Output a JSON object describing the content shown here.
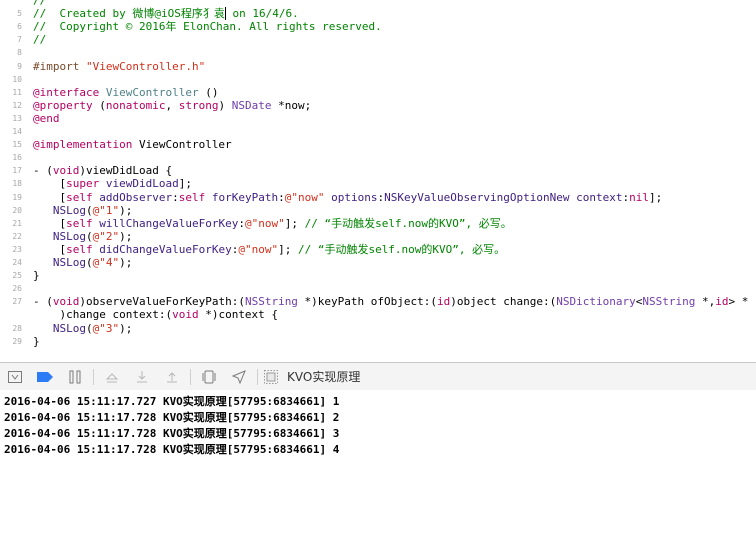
{
  "editor": {
    "colors": {
      "comment": "#008400",
      "keyword": "#b40062",
      "type": "#4f8187",
      "class": "#703daa",
      "method": "#3d1d81",
      "string": "#d12f1b",
      "number": "#272ad8",
      "pre": "#78492a"
    },
    "lines": [
      {
        "num": "",
        "tokens": [
          {
            "c": "comment",
            "t": "//"
          }
        ]
      },
      {
        "num": "5",
        "tokens": [
          {
            "c": "comment",
            "t": "//  Created by 微博@iOS程序犭袁"
          },
          {
            "c": "cursor",
            "t": ""
          },
          {
            "c": "comment",
            "t": " on 16/4/6."
          }
        ]
      },
      {
        "num": "6",
        "tokens": [
          {
            "c": "comment",
            "t": "//  Copyright © 2016年 ElonChan. All rights reserved."
          }
        ]
      },
      {
        "num": "7",
        "tokens": [
          {
            "c": "comment",
            "t": "//"
          }
        ]
      },
      {
        "num": "8",
        "tokens": []
      },
      {
        "num": "9",
        "tokens": [
          {
            "c": "pre",
            "t": "#import "
          },
          {
            "c": "string",
            "t": "\"ViewController.h\""
          }
        ]
      },
      {
        "num": "10",
        "tokens": []
      },
      {
        "num": "11",
        "tokens": [
          {
            "c": "keyword",
            "t": "@interface "
          },
          {
            "c": "type",
            "t": "ViewController"
          },
          {
            "c": "default",
            "t": " ()"
          }
        ]
      },
      {
        "num": "12",
        "tokens": [
          {
            "c": "keyword",
            "t": "@property"
          },
          {
            "c": "default",
            "t": " ("
          },
          {
            "c": "keyword",
            "t": "nonatomic"
          },
          {
            "c": "default",
            "t": ", "
          },
          {
            "c": "keyword",
            "t": "strong"
          },
          {
            "c": "default",
            "t": ") "
          },
          {
            "c": "class",
            "t": "NSDate"
          },
          {
            "c": "default",
            "t": " *now;"
          }
        ]
      },
      {
        "num": "13",
        "tokens": [
          {
            "c": "keyword",
            "t": "@end"
          }
        ]
      },
      {
        "num": "14",
        "tokens": []
      },
      {
        "num": "15",
        "tokens": [
          {
            "c": "keyword",
            "t": "@implementation"
          },
          {
            "c": "default",
            "t": " ViewController"
          }
        ]
      },
      {
        "num": "16",
        "tokens": []
      },
      {
        "num": "17",
        "tokens": [
          {
            "c": "default",
            "t": "- ("
          },
          {
            "c": "keyword",
            "t": "void"
          },
          {
            "c": "default",
            "t": ")viewDidLoad {"
          }
        ]
      },
      {
        "num": "18",
        "tokens": [
          {
            "c": "default",
            "t": "    ["
          },
          {
            "c": "keyword",
            "t": "super"
          },
          {
            "c": "default",
            "t": " "
          },
          {
            "c": "method",
            "t": "viewDidLoad"
          },
          {
            "c": "default",
            "t": "];"
          }
        ]
      },
      {
        "num": "19",
        "tokens": [
          {
            "c": "default",
            "t": "    ["
          },
          {
            "c": "keyword",
            "t": "self"
          },
          {
            "c": "default",
            "t": " "
          },
          {
            "c": "method",
            "t": "addObserver"
          },
          {
            "c": "default",
            "t": ":"
          },
          {
            "c": "keyword",
            "t": "self"
          },
          {
            "c": "default",
            "t": " "
          },
          {
            "c": "method",
            "t": "forKeyPath"
          },
          {
            "c": "default",
            "t": ":"
          },
          {
            "c": "string",
            "t": "@\"now\""
          },
          {
            "c": "default",
            "t": " "
          },
          {
            "c": "method",
            "t": "options"
          },
          {
            "c": "default",
            "t": ":"
          },
          {
            "c": "method",
            "t": "NSKeyValueObservingOptionNew"
          },
          {
            "c": "default",
            "t": " "
          },
          {
            "c": "method",
            "t": "context"
          },
          {
            "c": "default",
            "t": ":"
          },
          {
            "c": "keyword",
            "t": "nil"
          },
          {
            "c": "default",
            "t": "];"
          }
        ]
      },
      {
        "num": "20",
        "tokens": [
          {
            "c": "default",
            "t": "   "
          },
          {
            "c": "method",
            "t": "NSLog"
          },
          {
            "c": "default",
            "t": "("
          },
          {
            "c": "string",
            "t": "@\"1\""
          },
          {
            "c": "default",
            "t": ");"
          }
        ]
      },
      {
        "num": "21",
        "tokens": [
          {
            "c": "default",
            "t": "    ["
          },
          {
            "c": "keyword",
            "t": "self"
          },
          {
            "c": "default",
            "t": " "
          },
          {
            "c": "method",
            "t": "willChangeValueForKey"
          },
          {
            "c": "default",
            "t": ":"
          },
          {
            "c": "string",
            "t": "@\"now\""
          },
          {
            "c": "default",
            "t": "]; "
          },
          {
            "c": "comment",
            "t": "// “手动触发self.now的KVO”, 必写。"
          }
        ]
      },
      {
        "num": "22",
        "tokens": [
          {
            "c": "default",
            "t": "   "
          },
          {
            "c": "method",
            "t": "NSLog"
          },
          {
            "c": "default",
            "t": "("
          },
          {
            "c": "string",
            "t": "@\"2\""
          },
          {
            "c": "default",
            "t": ");"
          }
        ]
      },
      {
        "num": "23",
        "tokens": [
          {
            "c": "default",
            "t": "    ["
          },
          {
            "c": "keyword",
            "t": "self"
          },
          {
            "c": "default",
            "t": " "
          },
          {
            "c": "method",
            "t": "didChangeValueForKey"
          },
          {
            "c": "default",
            "t": ":"
          },
          {
            "c": "string",
            "t": "@\"now\""
          },
          {
            "c": "default",
            "t": "]; "
          },
          {
            "c": "comment",
            "t": "// “手动触发self.now的KVO”, 必写。"
          }
        ]
      },
      {
        "num": "24",
        "tokens": [
          {
            "c": "default",
            "t": "   "
          },
          {
            "c": "method",
            "t": "NSLog"
          },
          {
            "c": "default",
            "t": "("
          },
          {
            "c": "string",
            "t": "@\"4\""
          },
          {
            "c": "default",
            "t": ");"
          }
        ]
      },
      {
        "num": "25",
        "tokens": [
          {
            "c": "default",
            "t": "}"
          }
        ]
      },
      {
        "num": "26",
        "tokens": []
      },
      {
        "num": "27",
        "tokens": [
          {
            "c": "default",
            "t": "- ("
          },
          {
            "c": "keyword",
            "t": "void"
          },
          {
            "c": "default",
            "t": ")observeValueForKeyPath:("
          },
          {
            "c": "class",
            "t": "NSString"
          },
          {
            "c": "default",
            "t": " *)keyPath ofObject:("
          },
          {
            "c": "keyword",
            "t": "id"
          },
          {
            "c": "default",
            "t": ")object change:("
          },
          {
            "c": "class",
            "t": "NSDictionary"
          },
          {
            "c": "default",
            "t": "<"
          },
          {
            "c": "class",
            "t": "NSString"
          },
          {
            "c": "default",
            "t": " *,"
          },
          {
            "c": "keyword",
            "t": "id"
          },
          {
            "c": "default",
            "t": "> *"
          }
        ]
      },
      {
        "num": "",
        "tokens": [
          {
            "c": "default",
            "t": "    )change context:("
          },
          {
            "c": "keyword",
            "t": "void"
          },
          {
            "c": "default",
            "t": " *)context {"
          }
        ]
      },
      {
        "num": "28",
        "tokens": [
          {
            "c": "default",
            "t": "   "
          },
          {
            "c": "method",
            "t": "NSLog"
          },
          {
            "c": "default",
            "t": "("
          },
          {
            "c": "string",
            "t": "@\"3\""
          },
          {
            "c": "default",
            "t": ");"
          }
        ]
      },
      {
        "num": "29",
        "tokens": [
          {
            "c": "default",
            "t": "}"
          }
        ]
      }
    ]
  },
  "debug_bar": {
    "buttons": [
      {
        "name": "hide-debug-area-icon"
      },
      {
        "name": "breakpoints-toggle-icon"
      },
      {
        "name": "pause-continue-icon"
      },
      {
        "name": "step-over-icon"
      },
      {
        "name": "step-into-icon"
      },
      {
        "name": "step-out-icon"
      },
      {
        "name": "view-hierarchy-icon"
      },
      {
        "name": "simulate-location-icon"
      }
    ],
    "process_name": "KVO实现原理"
  },
  "console": {
    "lines": [
      "2016-04-06 15:11:17.727 KVO实现原理[57795:6834661] 1",
      "2016-04-06 15:11:17.728 KVO实现原理[57795:6834661] 2",
      "2016-04-06 15:11:17.728 KVO实现原理[57795:6834661] 3",
      "2016-04-06 15:11:17.728 KVO实现原理[57795:6834661] 4"
    ]
  }
}
